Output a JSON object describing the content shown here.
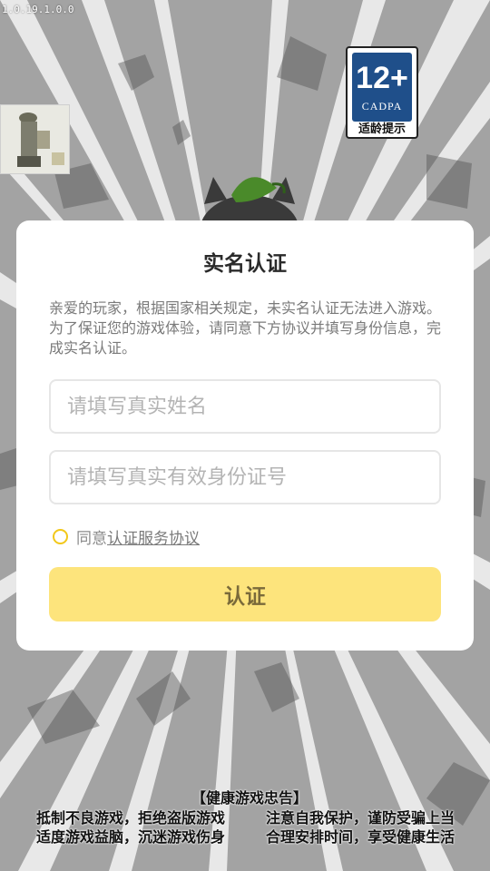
{
  "version": "1.0.19.1.0.0",
  "age_badge": {
    "rating": "12+",
    "org": "CADPA",
    "tip": "适龄提示",
    "color": "#1f4f8a"
  },
  "dialog": {
    "title": "实名认证",
    "description": "亲爱的玩家，根据国家相关规定，未实名认证无法进入游戏。为了保证您的游戏体验，请同意下方协议并填写身份信息，完成实名认证。",
    "name_field": {
      "placeholder": "请填写真实姓名",
      "value": ""
    },
    "id_field": {
      "placeholder": "请填写真实有效身份证号",
      "value": ""
    },
    "agree_prefix": "同意",
    "agree_link": "认证服务协议",
    "agree_checked": false,
    "submit_label": "认证",
    "accent_color": "#fde47c"
  },
  "health_notice": {
    "title": "【健康游戏忠告】",
    "lines": [
      "抵制不良游戏，拒绝盗版游戏",
      "注意自我保护，谨防受骗上当",
      "适度游戏益脑，沉迷游戏伤身",
      "合理安排时间，享受健康生活"
    ]
  }
}
